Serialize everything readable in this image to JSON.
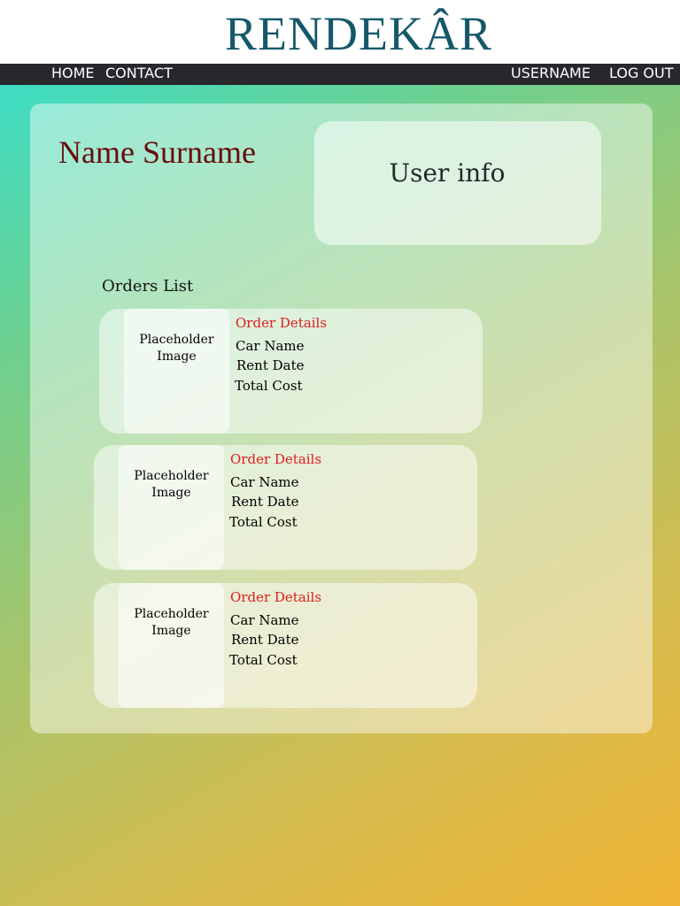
{
  "brand": {
    "logo_text": "RENDEKÂR",
    "logo_color": "#15586a"
  },
  "nav": {
    "home": "HOME",
    "contact": "CONTACT",
    "username": "USERNAME",
    "logout": "LOG OUT"
  },
  "profile": {
    "name": "Name Surname",
    "user_info_label": "User info"
  },
  "orders": {
    "title": "Orders List",
    "items": [
      {
        "image_label_line1": "Placeholder",
        "image_label_line2": "Image",
        "details_title": "Order Details",
        "car_name": "Car Name",
        "rent_date": "Rent Date",
        "total_cost": "Total Cost"
      },
      {
        "image_label_line1": "Placeholder",
        "image_label_line2": "Image",
        "details_title": "Order Details",
        "car_name": "Car Name",
        "rent_date": "Rent Date",
        "total_cost": "Total Cost"
      },
      {
        "image_label_line1": "Placeholder",
        "image_label_line2": "Image",
        "details_title": "Order Details",
        "car_name": "Car Name",
        "rent_date": "Rent Date",
        "total_cost": "Total Cost"
      }
    ]
  },
  "colors": {
    "name_color": "#6a0c0c",
    "details_title_color": "#e01b1b",
    "nav_background": "#27272c"
  }
}
